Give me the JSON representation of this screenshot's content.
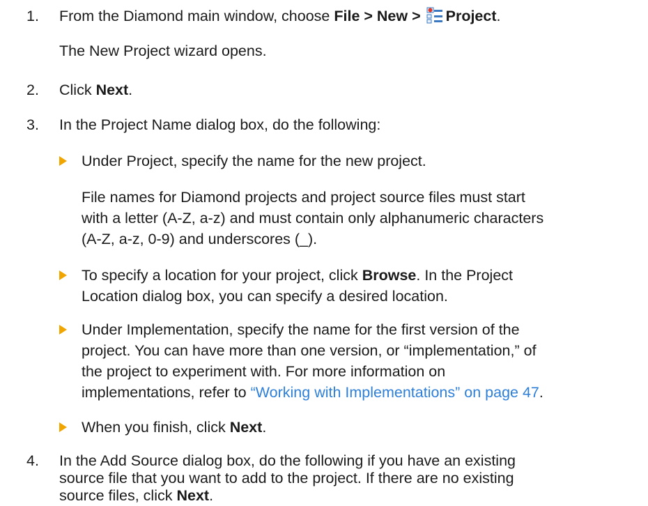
{
  "step1": {
    "num": "1.",
    "prefix": "From the Diamond main window, choose ",
    "menu_path": "File > New > ",
    "menu_item": "Project",
    "suffix": ".",
    "note": "The New Project wizard opens."
  },
  "step2": {
    "num": "2.",
    "prefix": "Click ",
    "button": "Next",
    "suffix": "."
  },
  "step3": {
    "num": "3.",
    "text": "In the Project Name dialog box, do the following:",
    "bullet1": {
      "text": "Under Project, specify the name for the new project.",
      "note_lines": [
        "File names for Diamond projects and project source files must start",
        "with a letter (A-Z, a-z) and must contain only alphanumeric characters",
        "(A-Z, a-z, 0-9) and underscores (_)."
      ]
    },
    "bullet2": {
      "line1_prefix": "To specify a location for your project, click ",
      "line1_button": "Browse",
      "line1_suffix": ". In the Project",
      "line2": "Location dialog box, you can specify a desired location."
    },
    "bullet3": {
      "lines": [
        "Under Implementation, specify the name for the first version of the",
        "project. You can have more than one version, or “implementation,” of",
        "the project to experiment with. For more information on"
      ],
      "line4_prefix": "implementations, refer to ",
      "link": "“Working with Implementations” on page 47",
      "line4_suffix": "."
    },
    "bullet4": {
      "prefix": "When you finish, click ",
      "button": "Next",
      "suffix": "."
    }
  },
  "step4": {
    "num": "4.",
    "lines": [
      "In the Add Source dialog box, do the following if you have an existing",
      "source file that you want to add to the project. If there are no existing"
    ],
    "line3_prefix": "source files, click ",
    "line3_button": "Next",
    "line3_suffix": "."
  },
  "colors": {
    "text": "#1a1a1a",
    "link": "#2e7fd9",
    "bullet": "#f0a500"
  },
  "icons": {
    "project": "project-icon",
    "bullet": "bullet-triangle-icon"
  }
}
